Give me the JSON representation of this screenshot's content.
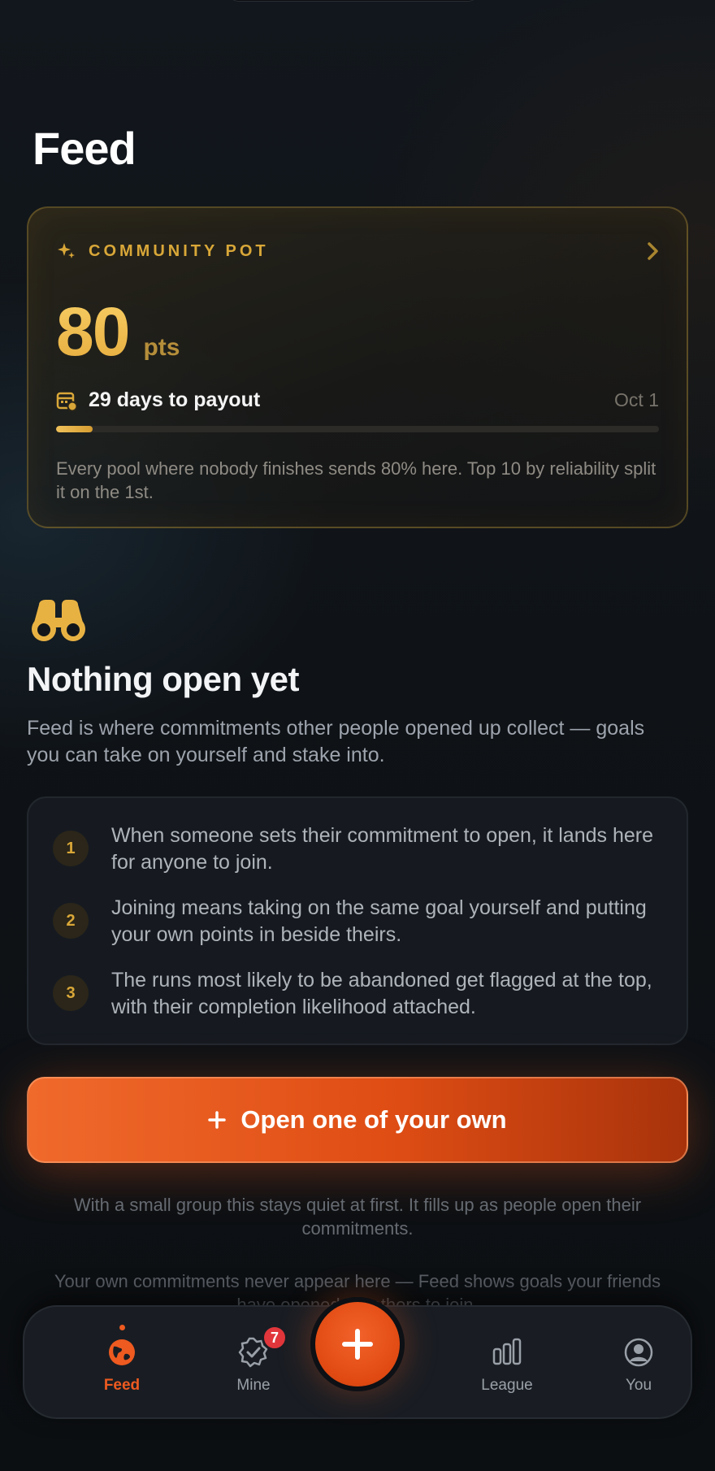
{
  "page": {
    "title": "Feed"
  },
  "community_pot": {
    "label": "COMMUNITY POT",
    "value": "80",
    "unit": "pts",
    "countdown": "29 days to payout",
    "payout_date": "Oct 1",
    "progress": 0.06,
    "note": "Every pool where nobody finishes sends 80% here. Top 10 by reliability split it on the 1st.",
    "accent_color": "#d9a738"
  },
  "empty_state": {
    "title": "Nothing open yet",
    "description": "Feed is where commitments other people opened up collect — goals you can take on yourself and stake into.",
    "steps": [
      {
        "number": "1",
        "text": "When someone sets their commitment to open, it lands here for anyone to join."
      },
      {
        "number": "2",
        "text": "Joining means taking on the same goal yourself and putting your own points in beside theirs."
      },
      {
        "number": "3",
        "text": "The runs most likely to be abandoned get flagged at the top, with their completion likelihood attached."
      }
    ],
    "cta_label": "Open one of your own",
    "footnote_1": "With a small group this stays quiet at first. It fills up as people open their commitments.",
    "footnote_2": "Your own commitments never appear here — Feed shows goals your friends have opened for others to join."
  },
  "bottom_nav": {
    "items": [
      {
        "label": "Feed",
        "icon": "globe-icon",
        "active": true
      },
      {
        "label": "Mine",
        "icon": "verified-check-icon",
        "badge": "7"
      },
      {
        "label": "League",
        "icon": "bar-chart-icon"
      },
      {
        "label": "You",
        "icon": "user-circle-icon"
      }
    ],
    "fab_icon": "plus-icon",
    "active_color": "#ee5a20"
  }
}
